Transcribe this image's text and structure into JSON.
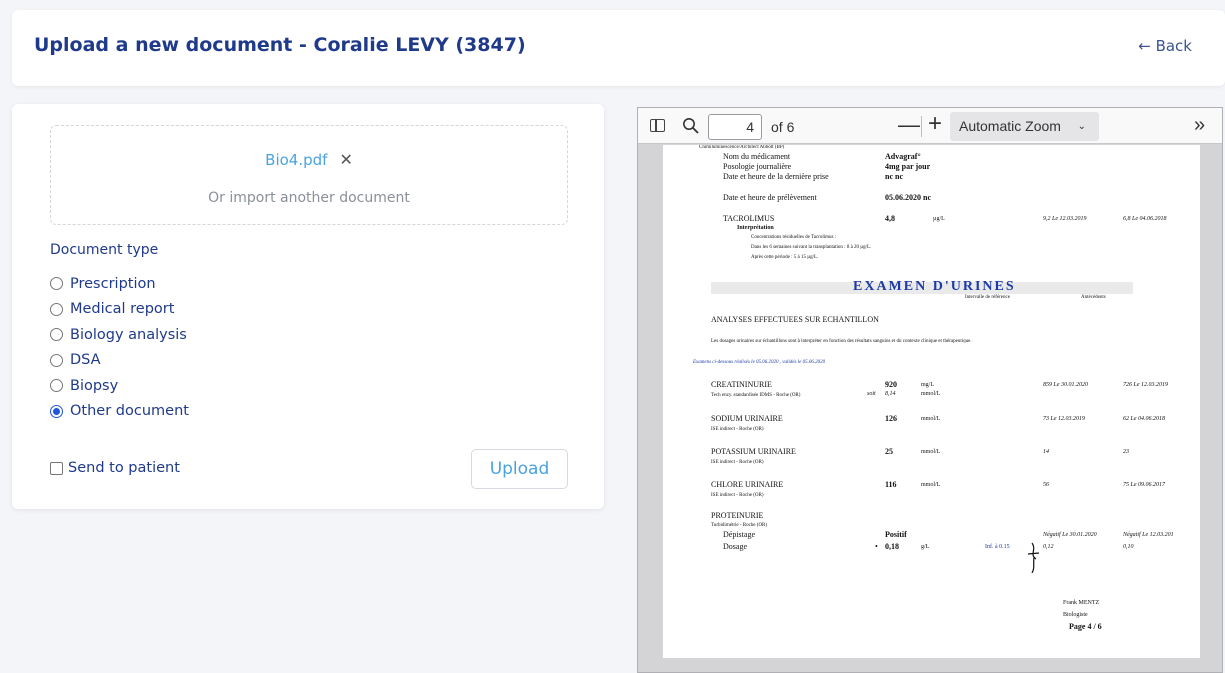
{
  "header": {
    "title": "Upload a new document - Coralie LEVY (3847)",
    "back": "← Back"
  },
  "form": {
    "file_name": "Bio4.pdf",
    "remove_symbol": "✕",
    "import_another": "Or import another document",
    "doc_type_label": "Document type",
    "options": [
      "Prescription",
      "Medical report",
      "Biology analysis",
      "DSA",
      "Biopsy",
      "Other document"
    ],
    "selected_option": "Other document",
    "send_to_patient": "Send to patient",
    "send_to_patient_checked": false,
    "upload": "Upload"
  },
  "viewer": {
    "page_number": "4",
    "page_of": "of 6",
    "zoom_out": "—",
    "zoom_in": "+",
    "zoom": "Automatic Zoom",
    "chevron": "⌄",
    "more": "»"
  },
  "doc": {
    "method_top": "Chimiluminescence/Architect Abbott (BP)",
    "med_name_label": "Nom du médicament",
    "med_name": "Advagraf°",
    "posology_label": "Posologie journalière",
    "posology": "4mg par jour",
    "last_dose_label": "Date et heure de la dernière prise",
    "last_dose": "nc    nc",
    "sampling_label": "Date et heure de prélèvement",
    "sampling": "05.06.2020    nc",
    "tacro_label": "TACROLIMUS",
    "tacro_value": "4,8",
    "tacro_unit": "µg/L",
    "tacro_prev1": "9,2  Le 12.03.2019",
    "tacro_prev2": "6,8  Le 04.06.2018",
    "interp_label": "Interprétation",
    "interp1": "Concentrations résiduelles de Tacrolimus :",
    "interp2": "Dans les 6 semaines suivant la transplantation : 8 à 20 µg/L.",
    "interp3": "Après cette période : 5 à 15 µg/L.",
    "exam_title": "EXAMEN D'URINES",
    "ref_interval": "Intervalle de référence",
    "history": "Antécédents",
    "analyses_title": "ANALYSES EFFECTUEES SUR ECHANTILLON",
    "analyses_note": "Les dosages urinaires sur échantillons sont à interpréter en fonction des résultats sanguins et du contexte clinique et thérapeutique.",
    "exams_dates": "Examens ci-dessous réalisés le 05.06.2020  , validés le 05.06.2020",
    "rows": [
      {
        "name": "CREATININURIE",
        "method": "Tech enzy. standardisée IDMS - Roche (OR)",
        "value": "920",
        "unit": "mg/L",
        "prev1": "859  Le 30.01.2020",
        "prev2": "726  Le 12.03.2019"
      },
      {
        "name": "SODIUM URINAIRE",
        "method": "ISE indirect - Roche (OR)",
        "value": "126",
        "unit": "mmol/L",
        "prev1": "73  Le 12.03.2019",
        "prev2": "62  Le 04.06.2018"
      },
      {
        "name": "POTASSIUM URINAIRE",
        "method": "ISE indirect - Roche (OR)",
        "value": "25",
        "unit": "mmol/L",
        "prev1": "14",
        "prev2": "23"
      },
      {
        "name": "CHLORE URINAIRE",
        "method": "ISE indirect - Roche (OR)",
        "value": "116",
        "unit": "mmol/L",
        "prev1": "56",
        "prev2": "75  Le 09.06.2017"
      }
    ],
    "creat_soit": "soit",
    "creat_soit_value": "8,14",
    "creat_soit_unit": "mmol/L",
    "prot_title": "PROTEINURIE",
    "prot_method": "Turbidimétrie - Roche (OR)",
    "depistage_label": "Dépistage",
    "depistage_value": "Positif",
    "depistage_prev1": "Négatif  Le 30.01.2020",
    "depistage_prev2": "Négatif  Le 12.03.201",
    "dosage_label": "Dosage",
    "dosage_marker": "•",
    "dosage_value": "0,18",
    "dosage_unit": "g/L",
    "dosage_ref": "Inf. à 0.15",
    "dosage_prev1": "0,12",
    "dosage_prev2": "0,10",
    "signer": "Frank MENTZ",
    "signer_role": "Biologiste",
    "page_label": "Page  4 / 6"
  }
}
